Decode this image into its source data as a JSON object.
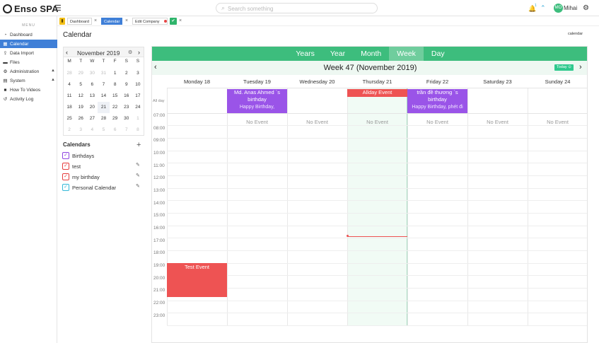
{
  "topbar": {
    "brand": "Enso SPA",
    "search_placeholder": "Search something",
    "notification_count": "1",
    "user_initials": "MO",
    "user_name": "Mihai"
  },
  "sidebar": {
    "menu_header": "MENU",
    "items": [
      {
        "label": "Dashboard",
        "icon": "tachometer-icon"
      },
      {
        "label": "Calendar",
        "icon": "calendar-icon",
        "active": true
      },
      {
        "label": "Data Import",
        "icon": "upload-icon"
      },
      {
        "label": "Files",
        "icon": "folder-icon"
      },
      {
        "label": "Administration",
        "icon": "users-cog-icon"
      },
      {
        "label": "System",
        "icon": "server-icon"
      },
      {
        "label": "How To Videos",
        "icon": "video-icon"
      },
      {
        "label": "Activity Log",
        "icon": "history-icon"
      }
    ]
  },
  "tabs": [
    {
      "label": "Dashboard"
    },
    {
      "label": "Calendar",
      "active": true
    },
    {
      "label": "Edit Company"
    }
  ],
  "page": {
    "title": "Calendar",
    "breadcrumb": "calendar"
  },
  "mini_calendar": {
    "title": "November 2019",
    "weekdays": [
      "M",
      "T",
      "W",
      "T",
      "F",
      "S",
      "S"
    ],
    "weeks": [
      [
        "28",
        "29",
        "30",
        "31",
        "1",
        "2",
        "3"
      ],
      [
        "4",
        "5",
        "6",
        "7",
        "8",
        "9",
        "10"
      ],
      [
        "11",
        "12",
        "13",
        "14",
        "15",
        "16",
        "17"
      ],
      [
        "18",
        "19",
        "20",
        "21",
        "22",
        "23",
        "24"
      ],
      [
        "25",
        "26",
        "27",
        "28",
        "29",
        "30",
        "1"
      ],
      [
        "2",
        "3",
        "4",
        "5",
        "6",
        "7",
        "8"
      ]
    ]
  },
  "calendars": {
    "title": "Calendars",
    "items": [
      {
        "label": "Birthdays",
        "color": "#8e44e0",
        "editable": false
      },
      {
        "label": "test",
        "color": "#e53c3c",
        "editable": true
      },
      {
        "label": "my birthday",
        "color": "#e53c3c",
        "editable": true
      },
      {
        "label": "Personal Calendar",
        "color": "#34b8d8",
        "editable": true
      }
    ]
  },
  "week_view": {
    "views": [
      "Years",
      "Year",
      "Month",
      "Week",
      "Day"
    ],
    "active_view": "Week",
    "title": "Week 47 (November 2019)",
    "today_label": "Today",
    "all_day_label": "All day",
    "days": [
      "Monday 18",
      "Tuesday 19",
      "Wednesday 20",
      "Thursday 21",
      "Friday 22",
      "Saturday 23",
      "Sunday 24"
    ],
    "hours": [
      "07:00",
      "08:00",
      "09:00",
      "10:00",
      "11:00",
      "12:00",
      "13:00",
      "14:00",
      "15:00",
      "16:00",
      "17:00",
      "18:00",
      "19:00",
      "20:00",
      "21:00",
      "22:00",
      "23:00"
    ],
    "no_event_label": "No Event",
    "all_day_events": [
      {
        "title": "Md. Anas Ahmed `s birthday",
        "subtitle": "Happy Birthday,",
        "day": "Tuesday 19"
      },
      {
        "title": "Allday Event",
        "day": "Thursday 21"
      },
      {
        "title": "trần đề thương `s birthday",
        "subtitle": "Happy Birthday, phét đi",
        "day": "Friday 22"
      }
    ],
    "timed_events": [
      {
        "title": "Test Event",
        "day": "Monday 18",
        "start": "19:00",
        "end": "21:40"
      }
    ],
    "colors": {
      "accent": "#3dbd7d",
      "event_purple": "#9a54e8",
      "event_red": "#ee5353"
    }
  }
}
